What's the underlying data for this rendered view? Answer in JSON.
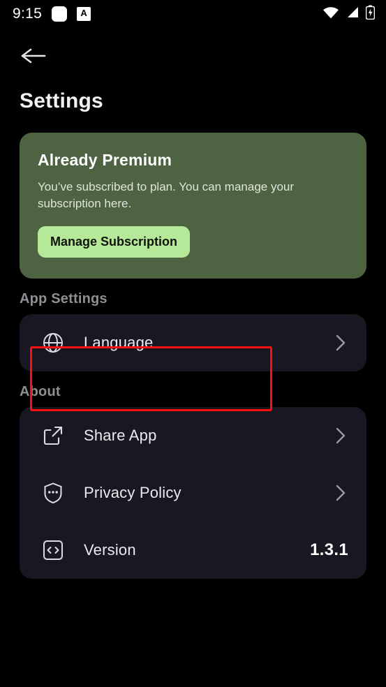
{
  "status_bar": {
    "time": "9:15",
    "left_icons": [
      "rounded-square-icon",
      "a-badge-icon"
    ],
    "a_badge_label": "A",
    "right_icons": [
      "wifi-icon",
      "cellular-signal-icon",
      "battery-charging-icon"
    ]
  },
  "header": {
    "back_icon": "arrow-left-icon",
    "title": "Settings"
  },
  "premium_card": {
    "title": "Already Premium",
    "description": "You’ve subscribed to  plan. You can manage your subscription here.",
    "button_label": "Manage Subscription",
    "bg_color": "#4d6342",
    "button_color": "#b6e89a"
  },
  "sections": [
    {
      "label": "App Settings",
      "rows": [
        {
          "icon": "globe-icon",
          "label": "Language",
          "accessory": "chevron-right-icon",
          "highlighted": true
        }
      ]
    },
    {
      "label": "About",
      "rows": [
        {
          "icon": "share-external-icon",
          "label": "Share App",
          "accessory": "chevron-right-icon",
          "highlighted": false
        },
        {
          "icon": "shield-dots-icon",
          "label": "Privacy Policy",
          "accessory": "chevron-right-icon",
          "highlighted": false
        },
        {
          "icon": "code-brackets-icon",
          "label": "Version",
          "accessory": "value",
          "value": "1.3.1",
          "highlighted": false
        }
      ]
    }
  ],
  "annotation": {
    "highlight_color": "#ff0f0f",
    "target": "Language"
  },
  "theme": {
    "background": "#000000",
    "card_background": "#181822",
    "primary_text": "#e9e9ee",
    "secondary_text": "#8e8e93"
  }
}
